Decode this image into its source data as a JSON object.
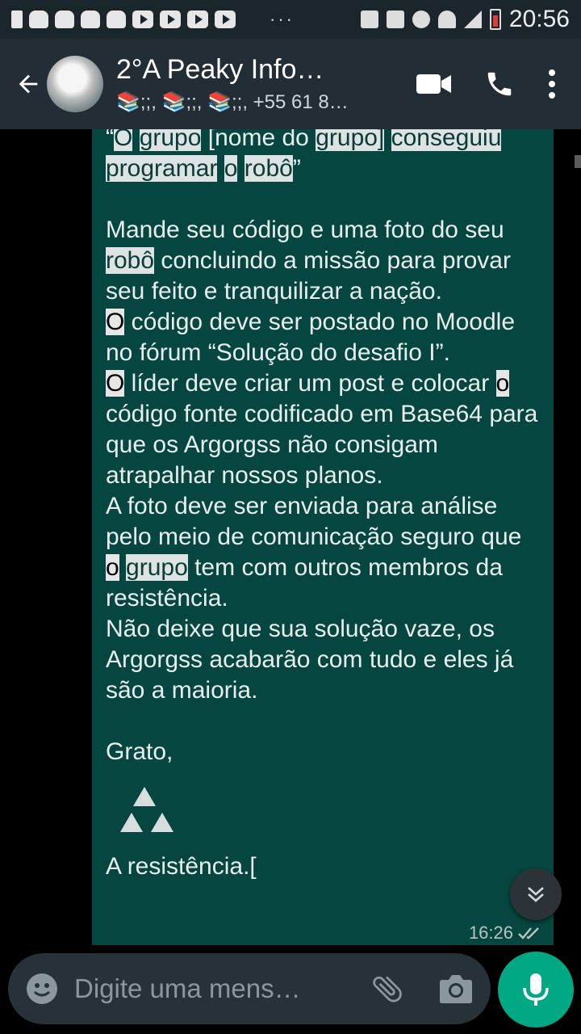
{
  "status_bar": {
    "time": "20:56",
    "overflow_dots": "···"
  },
  "header": {
    "title": "2°A Peaky Info…",
    "subtitle": "📚;;, 📚;;, 📚;;, +55 61 81…"
  },
  "message": {
    "first_line_pre": "“",
    "w_O": "O",
    "w_grupo": "grupo",
    "w_nome": "[nome do",
    "w_grupo2": "grupo]",
    "w_conseguiu": "conseguiu",
    "w_programar": "programar",
    "w_o": "o",
    "w_robo": "robô",
    "close_quote": "”",
    "p1a": "Mande seu código e uma foto do seu ",
    "p1_robo": "robô",
    "p1b": " concluindo a missão para provar seu feito e tranquilizar a nação.",
    "p2_O": "O",
    "p2b": " código deve ser postado no Moodle no fórum “Solução do desafio I”.",
    "p3_O": "O",
    "p3b": " líder deve criar um post e colocar ",
    "p3_o": "o",
    "p3c": " código fonte codificado em Base64 para que os Argorgss não consigam atrapalhar nossos planos.",
    "p4a": "A foto deve ser enviada para análise pelo meio de comunicação seguro que ",
    "p4_o": "o",
    "p4_sp": " ",
    "p4_grupo": "grupo",
    "p4b": " tem com outros membros da resistência.",
    "p5": "Não deixe que sua solução vaze, os Argorgss acabarão com tudo e eles já são a maioria.",
    "greeting": "Grato,",
    "signature": "A resistência.[",
    "time": "16:26"
  },
  "composer": {
    "placeholder": "Digite uma mens…"
  }
}
